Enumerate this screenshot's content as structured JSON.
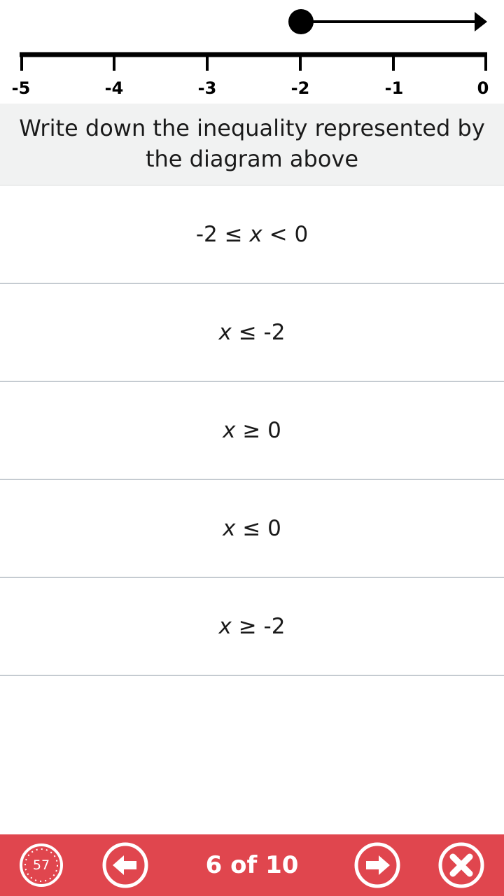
{
  "diagram": {
    "tick_labels": [
      "-5",
      "-4",
      "-3",
      "-2",
      "-1",
      "0"
    ],
    "closed_point_value": -2,
    "arrow_direction": "right"
  },
  "question": {
    "text": "Write down the inequality represented by the diagram above"
  },
  "answers": [
    {
      "pre": "-2 ≤ ",
      "var": "x",
      "post": " < 0"
    },
    {
      "pre": "",
      "var": "x",
      "post": " ≤ -2"
    },
    {
      "pre": "",
      "var": "x",
      "post": " ≥ 0"
    },
    {
      "pre": "",
      "var": "x",
      "post": " ≤ 0"
    },
    {
      "pre": "",
      "var": "x",
      "post": " ≥ -2"
    }
  ],
  "bottom_bar": {
    "timer": "57",
    "progress": "6 of 10",
    "prev_icon": "arrow-left-icon",
    "next_icon": "arrow-right-icon",
    "close_icon": "close-icon",
    "color": "#e0464e"
  }
}
